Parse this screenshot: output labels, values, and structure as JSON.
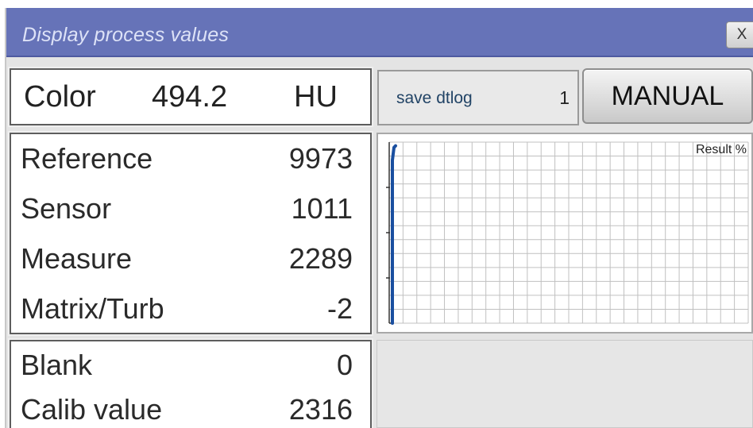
{
  "window": {
    "title": "Display process values",
    "close_label": "X"
  },
  "color_panel": {
    "label": "Color",
    "value": "494.2",
    "unit": "HU"
  },
  "measurements": [
    {
      "label": "Reference",
      "value": "9973"
    },
    {
      "label": "Sensor",
      "value": "1011"
    },
    {
      "label": "Measure",
      "value": "2289"
    },
    {
      "label": "Matrix/Turb",
      "value": "-2"
    }
  ],
  "calibration": [
    {
      "label": "Blank",
      "value": "0"
    },
    {
      "label": "Calib value",
      "value": "2316"
    }
  ],
  "log": {
    "label": "save dtlog",
    "count": "1"
  },
  "mode_button": {
    "label": "MANUAL"
  },
  "chart_data": {
    "type": "line",
    "title": "Result %",
    "xlabel": "",
    "ylabel": "",
    "grid": true,
    "series": [
      {
        "x": [
          0.0,
          0.02,
          0.1,
          0.5,
          0.98,
          1.0
        ],
        "y": [
          0.98,
          0.97,
          0.9,
          0.5,
          0.02,
          0.0
        ]
      }
    ],
    "colors": {
      "line": "#1a4fa0",
      "grid": "#c0c0c0"
    }
  }
}
